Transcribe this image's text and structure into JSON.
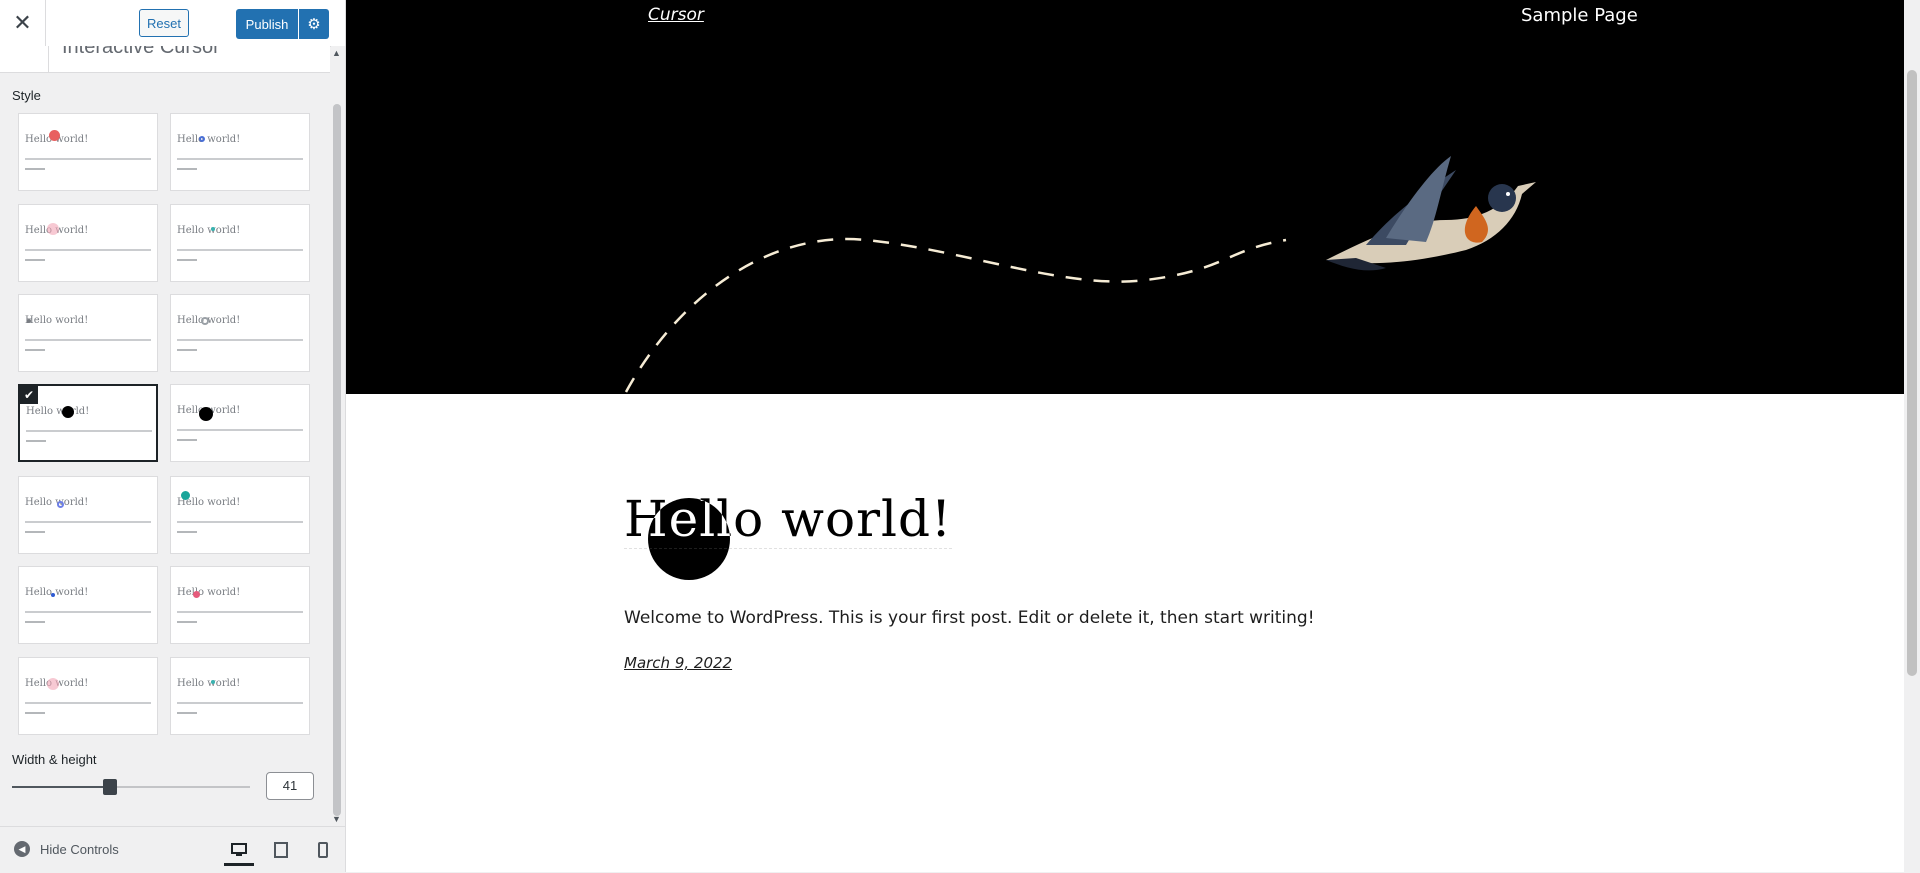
{
  "topbar": {
    "close_label": "✕",
    "reset_label": "Reset",
    "publish_label": "Publish",
    "publish_settings_icon": "gear-icon"
  },
  "section": {
    "title": "Interactive Cursor"
  },
  "style": {
    "label": "Style",
    "thumb_title": "Hello world!",
    "selected_index": 6,
    "options": [
      {
        "cursor": "red-dot",
        "color": "#e86060"
      },
      {
        "cursor": "blue-ring",
        "color": "#4a6fd6"
      },
      {
        "cursor": "pink-flower",
        "color": "#f2a5b5"
      },
      {
        "cursor": "teal-text",
        "color": "#3ab3b0"
      },
      {
        "cursor": "caret",
        "color": "#787c82"
      },
      {
        "cursor": "grey-ring",
        "color": "#9aa0a6"
      },
      {
        "cursor": "black-dot",
        "color": "#000000"
      },
      {
        "cursor": "black-dot-large",
        "color": "#000000"
      },
      {
        "cursor": "blue-ring-small",
        "color": "#6d7fe8"
      },
      {
        "cursor": "teal-dots",
        "color": "#1aa59a"
      },
      {
        "cursor": "blue-dot",
        "color": "#2f5bd3"
      },
      {
        "cursor": "pink-dot",
        "color": "#e55a7b"
      },
      {
        "cursor": "pink-flower-2",
        "color": "#f2a5b5"
      },
      {
        "cursor": "teal-text-2",
        "color": "#3ab3b0"
      }
    ]
  },
  "size": {
    "label": "Width & height",
    "value": "41",
    "fraction": 0.41
  },
  "footer": {
    "hide_controls_label": "Hide Controls",
    "devices": [
      "desktop",
      "tablet",
      "mobile"
    ],
    "active_device": "desktop"
  },
  "preview": {
    "site_title": "Cursor",
    "nav_item": "Sample Page",
    "post_title": "Hello world!",
    "post_excerpt": "Welcome to WordPress. This is your first post. Edit or delete it, then start writing!",
    "post_date": "March 9, 2022"
  }
}
